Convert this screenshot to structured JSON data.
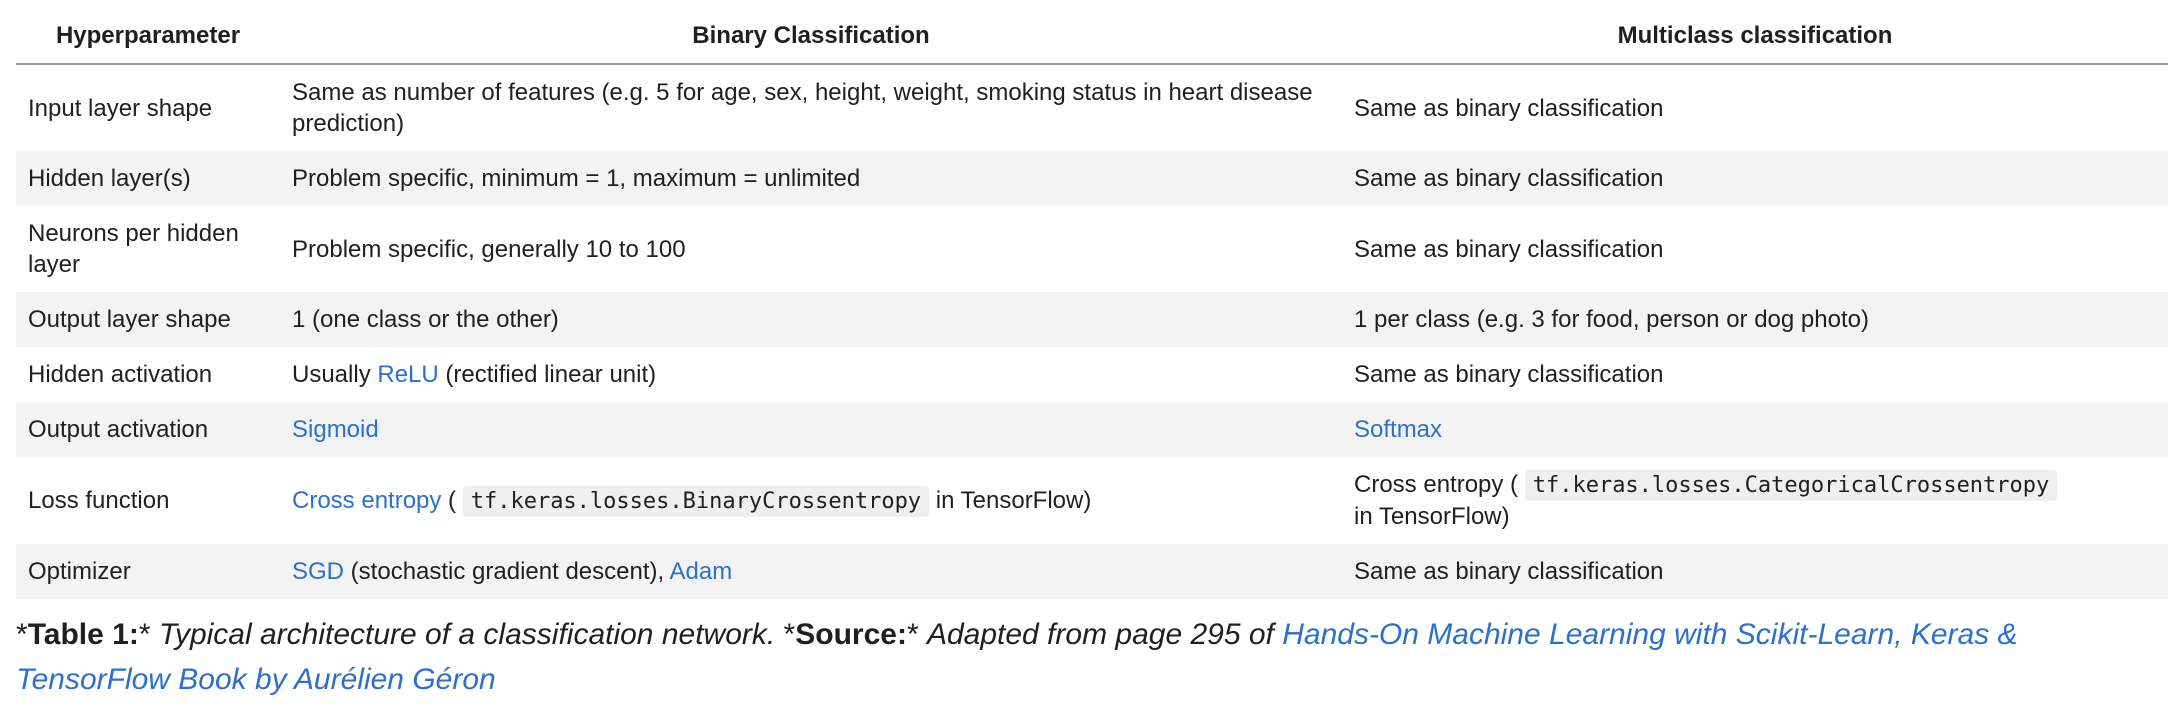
{
  "table": {
    "headers": [
      "Hyperparameter",
      "Binary Classification",
      "Multiclass classification"
    ],
    "rows": {
      "input_layer_shape": {
        "param": "Input layer shape",
        "binary": "Same as number of features (e.g. 5 for age, sex, height, weight, smoking status in heart disease prediction)",
        "multi": "Same as binary classification"
      },
      "hidden_layers": {
        "param": "Hidden layer(s)",
        "binary": "Problem specific, minimum = 1, maximum = unlimited",
        "multi": "Same as binary classification"
      },
      "neurons_per_hidden_layer": {
        "param": "Neurons per hidden layer",
        "binary": "Problem specific, generally 10 to 100",
        "multi": "Same as binary classification"
      },
      "output_layer_shape": {
        "param": "Output layer shape",
        "binary": "1 (one class or the other)",
        "multi": "1 per class (e.g. 3 for food, person or dog photo)"
      },
      "hidden_activation": {
        "param": "Hidden activation",
        "binary_prefix": "Usually ",
        "binary_link": "ReLU",
        "binary_suffix": " (rectified linear unit)",
        "multi": "Same as binary classification"
      },
      "output_activation": {
        "param": "Output activation",
        "binary_link": "Sigmoid",
        "multi_link": "Softmax"
      },
      "loss_function": {
        "param": "Loss function",
        "binary_link": "Cross entropy",
        "binary_open": " ( ",
        "binary_code": "tf.keras.losses.BinaryCrossentropy",
        "binary_suffix": " in TensorFlow)",
        "multi_prefix": "Cross entropy ( ",
        "multi_code": "tf.keras.losses.CategoricalCrossentropy",
        "multi_suffix": " in TensorFlow)"
      },
      "optimizer": {
        "param": "Optimizer",
        "binary_link1": "SGD",
        "binary_mid": " (stochastic gradient descent), ",
        "binary_link2": "Adam",
        "multi": "Same as binary classification"
      }
    }
  },
  "caption": {
    "star_open": "*",
    "table_label": "Table 1:",
    "star_close": "* ",
    "table_text": "Typical architecture of a classification network. ",
    "star_open2": "*",
    "source_label": "Source:",
    "star_close2": "* ",
    "source_text": "Adapted from page 295 of ",
    "book_link": "Hands-On Machine Learning with Scikit-Learn, Keras & TensorFlow Book by Aurélien Géron"
  },
  "colors": {
    "link": "#2a6fd1",
    "stripe": "#f3f3f3",
    "code_bg": "#efefef"
  }
}
